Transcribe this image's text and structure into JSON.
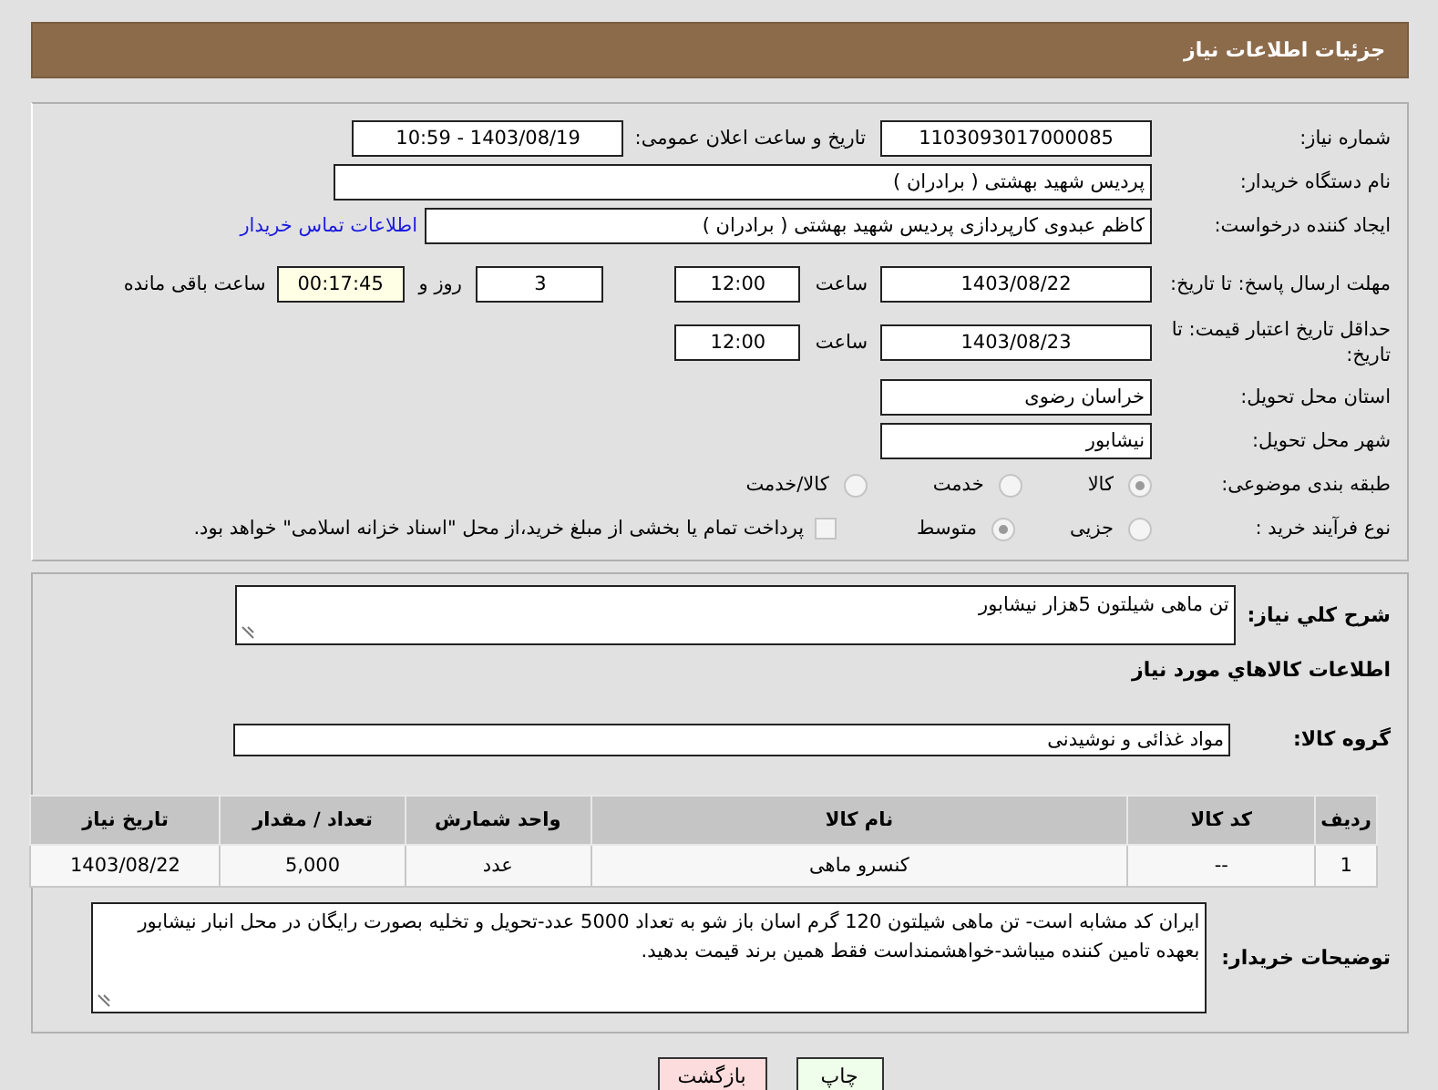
{
  "header": {
    "title": "جزئیات اطلاعات نیاز"
  },
  "details": {
    "need_number": {
      "label": "شماره نیاز:",
      "value": "1103093017000085"
    },
    "announce": {
      "label": "تاریخ و ساعت اعلان عمومی:",
      "value": "1403/08/19 - 10:59"
    },
    "buyer_org": {
      "label": "نام دستگاه خریدار:",
      "value": "پردیس شهید بهشتی ( برادران )"
    },
    "requester": {
      "label": "ایجاد کننده درخواست:",
      "value": "کاظم  عبدوی  کارپردازی  پردیس شهید بهشتی ( برادران )",
      "link": "اطلاعات تماس خریدار"
    },
    "reply_deadline": {
      "label": "مهلت ارسال پاسخ: تا تاریخ:",
      "date": "1403/08/22",
      "time_label": "ساعت",
      "time": "12:00",
      "days": "3",
      "days_label": "روز و",
      "remaining": "00:17:45",
      "remaining_label": "ساعت باقی مانده"
    },
    "price_validity": {
      "label": "حداقل تاریخ اعتبار قیمت: تا تاریخ:",
      "date": "1403/08/23",
      "time_label": "ساعت",
      "time": "12:00"
    },
    "province": {
      "label": "استان محل تحویل:",
      "value": "خراسان رضوی"
    },
    "city": {
      "label": "شهر محل تحویل:",
      "value": "نیشابور"
    },
    "category": {
      "label": "طبقه بندی موضوعی:",
      "options": [
        {
          "label": "کالا",
          "selected": true,
          "disabled": true
        },
        {
          "label": "خدمت",
          "selected": false,
          "disabled": true
        },
        {
          "label": "کالا/خدمت",
          "selected": false,
          "disabled": true
        }
      ]
    },
    "purchase_type": {
      "label": "نوع فرآیند خرید :",
      "options": [
        {
          "label": "جزیی",
          "selected": false,
          "disabled": true
        },
        {
          "label": "متوسط",
          "selected": true,
          "disabled": true
        }
      ],
      "treasury": {
        "label": "پرداخت تمام یا بخشی از مبلغ خرید،از محل \"اسناد خزانه اسلامی\" خواهد بود.",
        "checked": false,
        "disabled": true
      }
    }
  },
  "description": {
    "label": "شرح کلي نیاز:",
    "value": "تن ماهی شیلتون 5هزار نیشابور"
  },
  "goods_heading": "اطلاعات کالاهاي مورد نیاز",
  "goods_group": {
    "label": "گروه کالا:",
    "value": "مواد غذائی و نوشیدنی"
  },
  "table": {
    "columns": [
      "ردیف",
      "کد کالا",
      "نام کالا",
      "واحد شمارش",
      "تعداد / مقدار",
      "تاریخ نیاز"
    ],
    "rows": [
      [
        "1",
        "--",
        "کنسرو ماهی",
        "عدد",
        "5,000",
        "1403/08/22"
      ]
    ]
  },
  "buyer_notes": {
    "label": "توضیحات خریدار:",
    "value": "ایران کد مشابه است- تن ماهی شیلتون 120 گرم اسان باز شو به تعداد 5000 عدد-تحویل و تخلیه بصورت رایگان در محل انبار نیشابور بعهده تامین کننده میباشد-خواهشمنداست فقط همین برند قیمت بدهید."
  },
  "buttons": [
    {
      "label": "چاپ",
      "kind": "print"
    },
    {
      "label": "بازگشت",
      "kind": "back"
    }
  ]
}
